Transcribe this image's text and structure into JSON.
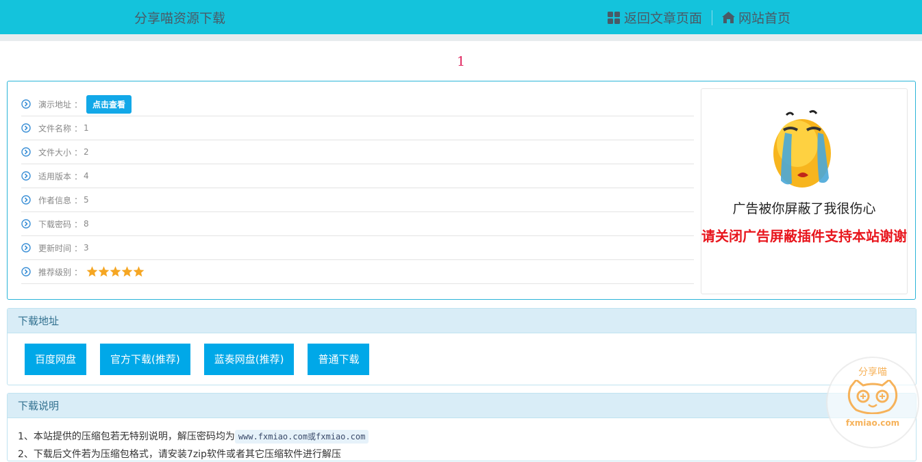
{
  "header": {
    "site_title": "分享喵资源下载",
    "nav": [
      {
        "label": "返回文章页面",
        "icon": "grid-icon"
      },
      {
        "label": "网站首页",
        "icon": "home-icon"
      }
    ]
  },
  "page_number": "1",
  "info": {
    "rows": [
      {
        "label": "演示地址",
        "sep": "：",
        "value": ""
      },
      {
        "label": "文件名称",
        "sep": "：",
        "value": "1"
      },
      {
        "label": "文件大小",
        "sep": "：",
        "value": "2"
      },
      {
        "label": "适用版本",
        "sep": "：",
        "value": "4"
      },
      {
        "label": "作者信息",
        "sep": "：",
        "value": "5"
      },
      {
        "label": "下载密码",
        "sep": "：",
        "value": "8"
      },
      {
        "label": "更新时间",
        "sep": "：",
        "value": "3"
      },
      {
        "label": "推荐级别",
        "sep": "：",
        "value": ""
      }
    ],
    "view_button": "点击查看",
    "rating_stars": 5
  },
  "ad": {
    "line1": "广告被你屏蔽了我很伤心",
    "line2": "请关闭广告屏蔽插件支持本站谢谢"
  },
  "download": {
    "title": "下载地址",
    "buttons": [
      "百度网盘",
      "官方下载(推荐)",
      "蓝奏网盘(推荐)",
      "普通下载"
    ]
  },
  "notes": {
    "title": "下载说明",
    "line1_prefix": "1、本站提供的压缩包若无特别说明，解压密码均为",
    "line1_code": "www.fxmiao.com或fxmiao.com",
    "line2": "2、下载后文件若为压缩包格式，请安装7zip软件或者其它压缩软件进行解压"
  },
  "watermark": {
    "text": "分享喵",
    "url": "fxmiao.com"
  },
  "colors": {
    "header_bg": "#14c3dc",
    "button_blue": "#00a8e8",
    "panel_head": "#d9edf7",
    "star": "#f5a623",
    "ad_red": "#e8151c"
  }
}
